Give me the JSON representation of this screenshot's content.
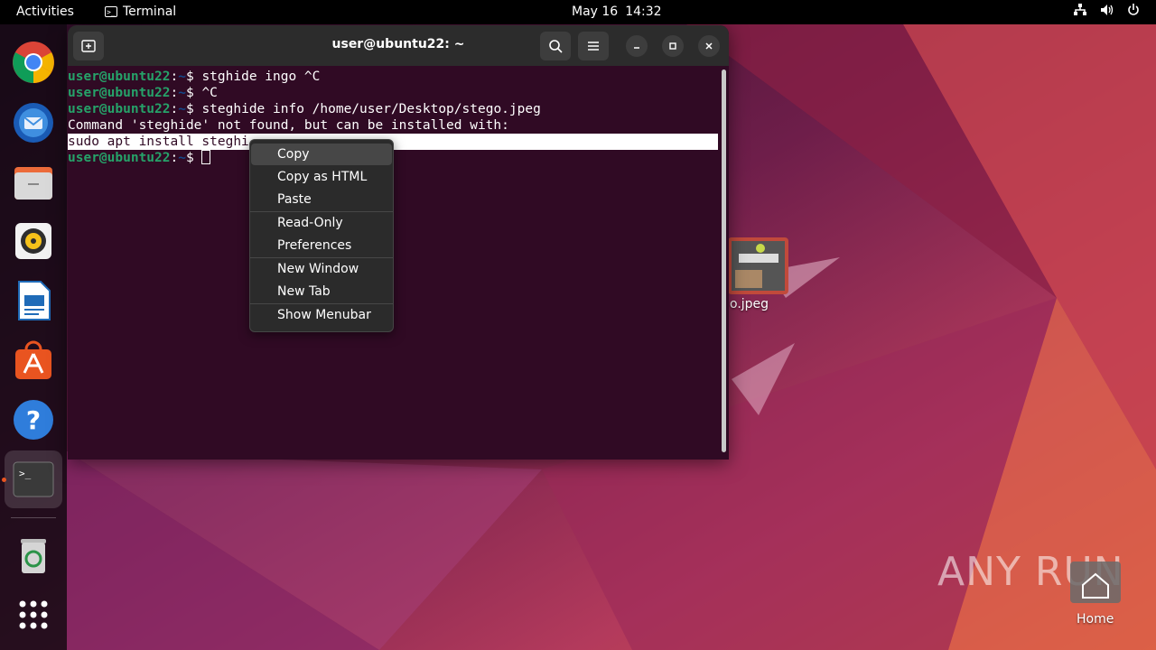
{
  "topbar": {
    "activities": "Activities",
    "app_name": "Terminal",
    "date": "May 16",
    "time": "14:32",
    "tray_icons": [
      "network-icon",
      "volume-icon",
      "power-icon"
    ]
  },
  "dock": {
    "items": [
      {
        "name": "chrome-icon"
      },
      {
        "name": "thunderbird-icon"
      },
      {
        "name": "files-icon"
      },
      {
        "name": "rhythmbox-icon"
      },
      {
        "name": "writer-icon"
      },
      {
        "name": "software-icon"
      },
      {
        "name": "help-icon"
      },
      {
        "name": "terminal-icon",
        "active": true
      },
      {
        "name": "trash-icon"
      },
      {
        "name": "app-grid-icon"
      }
    ]
  },
  "terminal": {
    "title": "user@ubuntu22: ~",
    "prompt_user": "user@ubuntu22",
    "prompt_sep": ":",
    "prompt_path": "~",
    "prompt_dollar": "$ ",
    "commands": [
      "stghide ingo ^C",
      "^C",
      "steghide info /home/user/Desktop/stego.jpeg"
    ],
    "output_line": "Command 'steghide' not found, but can be installed with:",
    "selected_line": "sudo apt install steghi"
  },
  "context_menu": {
    "items": [
      "Copy",
      "Copy as HTML",
      "Paste",
      "Read-Only",
      "Preferences",
      "New Window",
      "New Tab",
      "Show Menubar"
    ]
  },
  "desktop": {
    "stego_label": "o.jpeg",
    "home_label": "Home",
    "watermark": "ANY RUN"
  },
  "colors": {
    "terminal_bg": "#300a24",
    "prompt_user": "#26a269",
    "prompt_path": "#12488b",
    "accent": "#e95420"
  }
}
